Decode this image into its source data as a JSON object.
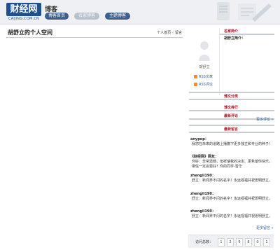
{
  "header": {
    "logo_text": "财经网",
    "logo_domain": "CAIJING.COM.CN",
    "section_title": "博客",
    "nav": [
      {
        "label": "博客首页"
      },
      {
        "label": "名家博客"
      },
      {
        "label": "主题博客"
      }
    ]
  },
  "main": {
    "space_title": "胡舒立的个人空间",
    "links": [
      "个人首页",
      "留言"
    ]
  },
  "sidebar": {
    "author_name": "胡舒立",
    "rss_article": "RSS文章",
    "rss_comment": "RSS评论",
    "headings": {
      "profile": "名家简介",
      "categories": "博文分类",
      "ranking": "博文排行",
      "latest_comments": "最新评论",
      "latest_messages": "最新留言"
    },
    "profile_label": "胡舒立简介：",
    "more_comments": "更多评论 »",
    "more_messages": "更多留言 »",
    "messages": [
      {
        "who": "anypop：",
        "text": "我您在未来的道路上播撒下更多独立和专业的种子！"
      },
      {
        "who": "《财经网》网友：",
        "text": "你好：非常遗憾，但祥瑞我的决定。更希望你快乐，相信一定会更好！你的同学-雪华"
      },
      {
        "who": "zhengli190：",
        "text": "舒立：新闻界不闪的名字！永远视福并祝愿明舒立。"
      },
      {
        "who": "zhengli190：",
        "text": "舒立：新闻界不闪的名字！永远视福并祝愿明舒立。"
      },
      {
        "who": "zhengli190：",
        "text": "舒立：新闻界不闪的名字！永远视福并祝愿明舒立。"
      }
    ],
    "visits_label": "访问总数：",
    "visit_digits": [
      "1",
      "2",
      "9",
      "8",
      "0",
      "1"
    ]
  },
  "colors": {
    "accent": "#b3141f",
    "nav_blue": "#3d5f8e",
    "link_blue": "#2c5a9c"
  }
}
